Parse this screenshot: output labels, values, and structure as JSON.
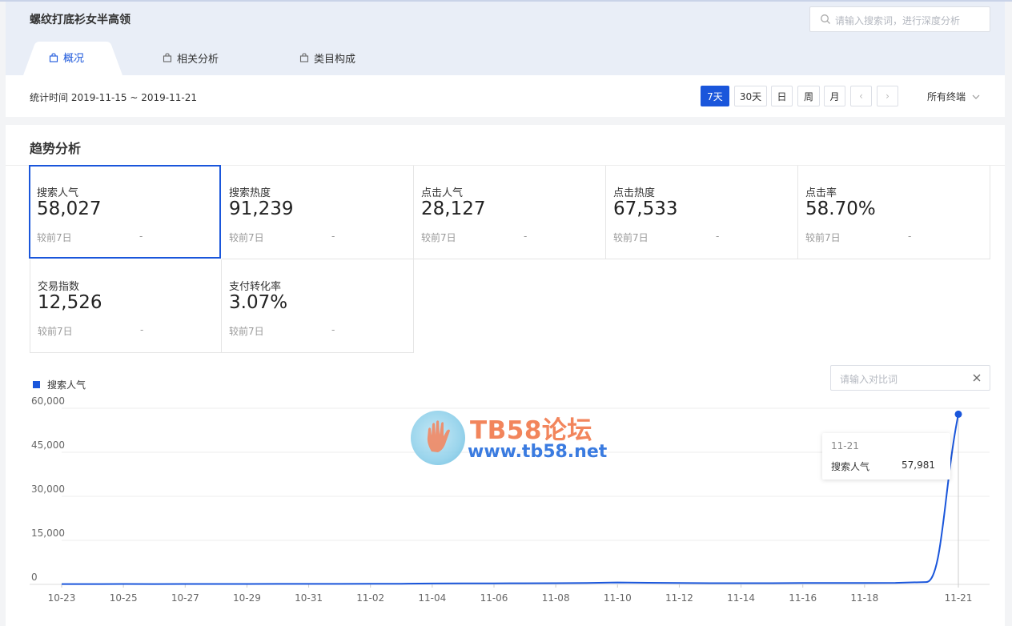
{
  "header": {
    "keyword_title": "螺纹打底衫女半高领",
    "search_placeholder": "请输入搜索词，进行深度分析",
    "tabs": [
      {
        "label": "概况",
        "active": true
      },
      {
        "label": "相关分析",
        "active": false
      },
      {
        "label": "类目构成",
        "active": false
      }
    ]
  },
  "filter": {
    "stat_time": "统计时间 2019-11-15 ~ 2019-11-21",
    "periods": [
      "7天",
      "30天",
      "日",
      "周",
      "月"
    ],
    "active_period": "7天",
    "prev_arrow": "‹",
    "next_arrow": "›",
    "terminal": "所有终端"
  },
  "panel": {
    "title": "趋势分析",
    "metrics": [
      {
        "label": "搜索人气",
        "value": "58,027",
        "compare_label": "较前7日",
        "compare_value": "-",
        "selected": true
      },
      {
        "label": "搜索热度",
        "value": "91,239",
        "compare_label": "较前7日",
        "compare_value": "-"
      },
      {
        "label": "点击人气",
        "value": "28,127",
        "compare_label": "较前7日",
        "compare_value": "-"
      },
      {
        "label": "点击热度",
        "value": "67,533",
        "compare_label": "较前7日",
        "compare_value": "-"
      },
      {
        "label": "点击率",
        "value": "58.70%",
        "compare_label": "较前7日",
        "compare_value": "-"
      },
      {
        "label": "交易指数",
        "value": "12,526",
        "compare_label": "较前7日",
        "compare_value": "-"
      },
      {
        "label": "支付转化率",
        "value": "3.07%",
        "compare_label": "较前7日",
        "compare_value": "-"
      }
    ],
    "compare_placeholder": "请输入对比词"
  },
  "tooltip": {
    "date": "11-21",
    "series_name": "搜索人气",
    "value": "57,981"
  },
  "watermark": {
    "line1": "TB58论坛",
    "line2": "www.tb58.net"
  },
  "colors": {
    "accent": "#1a56db",
    "grid": "#ececec"
  },
  "chart_data": {
    "type": "line",
    "series": [
      {
        "name": "搜索人气",
        "x": [
          "10-23",
          "10-24",
          "10-25",
          "10-26",
          "10-27",
          "10-28",
          "10-29",
          "10-30",
          "10-31",
          "11-01",
          "11-02",
          "11-03",
          "11-04",
          "11-05",
          "11-06",
          "11-07",
          "11-08",
          "11-09",
          "11-10",
          "11-11",
          "11-12",
          "11-13",
          "11-14",
          "11-15",
          "11-16",
          "11-17",
          "11-18",
          "11-19",
          "11-20",
          "11-21"
        ],
        "values": [
          120,
          110,
          130,
          120,
          125,
          130,
          140,
          150,
          160,
          170,
          180,
          220,
          300,
          350,
          360,
          380,
          420,
          500,
          650,
          550,
          450,
          420,
          400,
          420,
          450,
          480,
          500,
          520,
          800,
          57981
        ]
      }
    ],
    "x_tick_labels": [
      "10-23",
      "10-25",
      "10-27",
      "10-29",
      "10-31",
      "11-02",
      "11-04",
      "11-06",
      "11-08",
      "11-10",
      "11-12",
      "11-14",
      "11-16",
      "11-18",
      "11-21"
    ],
    "y_tick_labels": [
      "0",
      "15,000",
      "30,000",
      "45,000",
      "60,000"
    ],
    "ylim": [
      0,
      60000
    ],
    "xlabel": "",
    "ylabel": "",
    "legend": "top-left",
    "grid": true
  }
}
